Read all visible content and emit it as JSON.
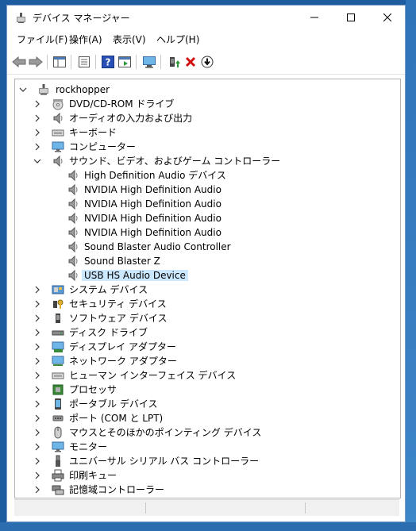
{
  "window": {
    "title": "デバイス マネージャー"
  },
  "menu": [
    "ファイル(F)",
    "操作(A)",
    "表示(V)",
    "ヘルプ(H)"
  ],
  "toolbar": {
    "buttons": [
      "back-arrow-icon",
      "forward-arrow-icon",
      "show-hide-console-tree-icon",
      "properties-icon",
      "help-icon",
      "action-pane-icon",
      "scan-hardware-icon",
      "update-driver-icon",
      "uninstall-icon",
      "disable-device-icon"
    ]
  },
  "tree": {
    "root": "rockhopper",
    "items": [
      {
        "label": "DVD/CD-ROM ドライブ",
        "icon": "dvd-icon"
      },
      {
        "label": "オーディオの入力および出力",
        "icon": "speaker-icon"
      },
      {
        "label": "キーボード",
        "icon": "keyboard-icon"
      },
      {
        "label": "コンピューター",
        "icon": "monitor-icon"
      },
      {
        "label": "サウンド、ビデオ、およびゲーム コントローラー",
        "icon": "speaker-icon",
        "expanded": true,
        "children": [
          "High Definition Audio デバイス",
          "NVIDIA High Definition Audio",
          "NVIDIA High Definition Audio",
          "NVIDIA High Definition Audio",
          "NVIDIA High Definition Audio",
          "Sound Blaster Audio Controller",
          "Sound Blaster Z",
          "USB HS Audio Device"
        ],
        "selected_child": 7
      },
      {
        "label": "システム デバイス",
        "icon": "system-device-icon"
      },
      {
        "label": "セキュリティ デバイス",
        "icon": "security-device-icon"
      },
      {
        "label": "ソフトウェア デバイス",
        "icon": "software-device-icon"
      },
      {
        "label": "ディスク ドライブ",
        "icon": "disk-drive-icon"
      },
      {
        "label": "ディスプレイ アダプター",
        "icon": "display-adapter-icon"
      },
      {
        "label": "ネットワーク アダプター",
        "icon": "network-adapter-icon"
      },
      {
        "label": "ヒューマン インターフェイス デバイス",
        "icon": "hid-icon"
      },
      {
        "label": "プロセッサ",
        "icon": "processor-icon"
      },
      {
        "label": "ポータブル デバイス",
        "icon": "portable-device-icon"
      },
      {
        "label": "ポート (COM と LPT)",
        "icon": "port-icon"
      },
      {
        "label": "マウスとそのほかのポインティング デバイス",
        "icon": "mouse-icon"
      },
      {
        "label": "モニター",
        "icon": "monitor-icon"
      },
      {
        "label": "ユニバーサル シリアル バス コントローラー",
        "icon": "usb-icon"
      },
      {
        "label": "印刷キュー",
        "icon": "printer-icon"
      },
      {
        "label": "記憶域コントローラー",
        "icon": "storage-controller-icon"
      }
    ]
  },
  "colors": {
    "selection": "#cce8ff",
    "accent": "#1d5c9e"
  }
}
